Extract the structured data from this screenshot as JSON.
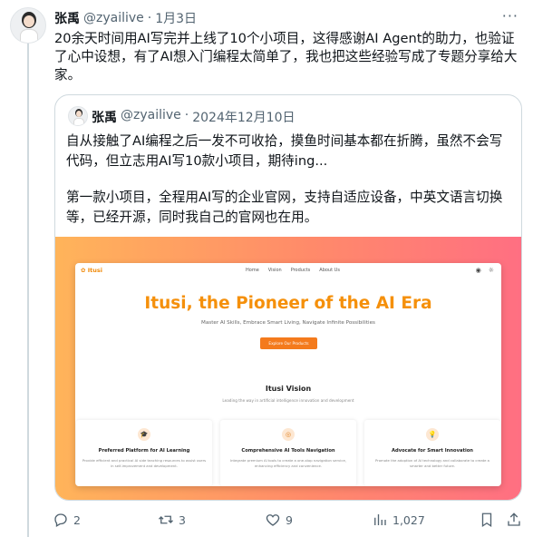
{
  "tweet": {
    "name": "张禹",
    "handle": "@zyailive",
    "separator": "·",
    "date": "1月3日",
    "more": "···",
    "text": "20余天时间用AI写完并上线了10个小项目，这得感谢AI Agent的助力，也验证了心中设想，有了AI想入门编程太简单了，我也把这些经验写成了专题分享给大家。"
  },
  "quote": {
    "name": "张禹",
    "handle": "@zyailive",
    "separator": "·",
    "date": "2024年12月10日",
    "paragraph1": "自从接触了AI编程之后一发不可收拾，摸鱼时间基本都在折腾，虽然不会写代码，但立志用AI写10款小项目，期待ing...",
    "paragraph2": "第一款小项目，全程用AI写的企业官网，支持自适应设备，中英文语言切换等，已经开源，同时我自己的官网也在用。"
  },
  "site": {
    "logo": "✿ Itusi",
    "nav": [
      "Home",
      "Vision",
      "Products",
      "About Us"
    ],
    "hero_title": "Itusi, the Pioneer of the AI Era",
    "hero_subtitle": "Master AI Skills, Embrace Smart Living, Navigate Infinite Possibilities",
    "cta": "Explore Our Products",
    "vision_title": "Itusi Vision",
    "vision_subtitle": "Leading the way in artificial intelligence innovation and development",
    "cards": [
      {
        "icon": "🎓",
        "title": "Preferred Platform for AI Learning",
        "desc": "Provide efficient and practical AI side teaching resources to assist users in self-improvement and development."
      },
      {
        "icon": "◎",
        "title": "Comprehensive AI Tools Navigation",
        "desc": "Integrate premium AI tools to create a one-stop navigation service, enhancing efficiency and convenience."
      },
      {
        "icon": "💡",
        "title": "Advocate for Smart Innovation",
        "desc": "Promote the adoption of AI technology and collaborate to create a smarter and better future."
      }
    ]
  },
  "actions": {
    "replies": "2",
    "retweets": "3",
    "likes": "9",
    "views": "1,027"
  },
  "colors": {
    "accent": "#f5900b",
    "text_secondary": "#536471",
    "border": "#cfd9de"
  }
}
